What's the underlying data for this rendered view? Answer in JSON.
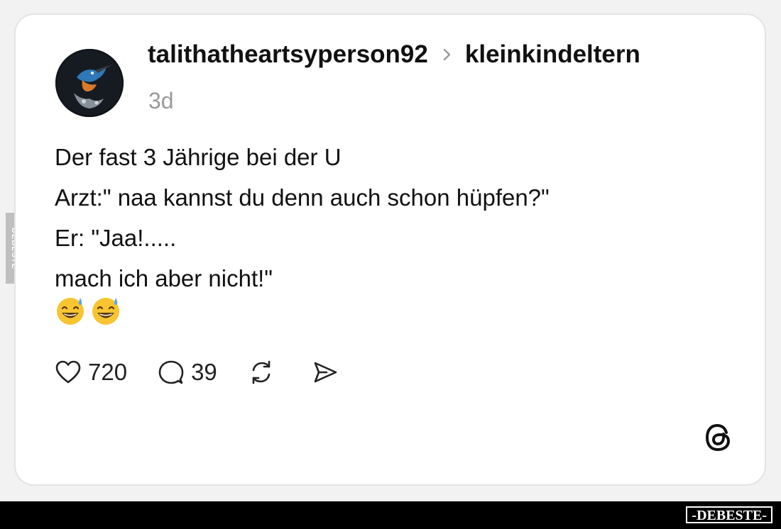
{
  "post": {
    "username": "talithatheartsyperson92",
    "community": "kleinkindeltern",
    "time": "3d",
    "lines": [
      "Der fast 3 Jährige bei der U",
      "Arzt:\" naa kannst du denn auch schon hüpfen?\"",
      "Er: \"Jaa!.....",
      "mach ich aber nicht!\""
    ],
    "emojis": [
      "grinning-sweat-emoji",
      "grinning-sweat-emoji"
    ]
  },
  "actions": {
    "likes": "720",
    "comments": "39",
    "repost_icon": "repost-icon",
    "share_icon": "share-icon"
  },
  "branding": {
    "threads_icon": "threads-logo-icon",
    "side_watermark": "DEBESTE",
    "bottom_watermark": "-DEBESTE-"
  },
  "colors": {
    "card_bg": "#ffffff",
    "text": "#111111",
    "muted": "#9a9a9a",
    "emoji_yellow": "#f7c531",
    "sweat_blue": "#5aa9e6"
  }
}
